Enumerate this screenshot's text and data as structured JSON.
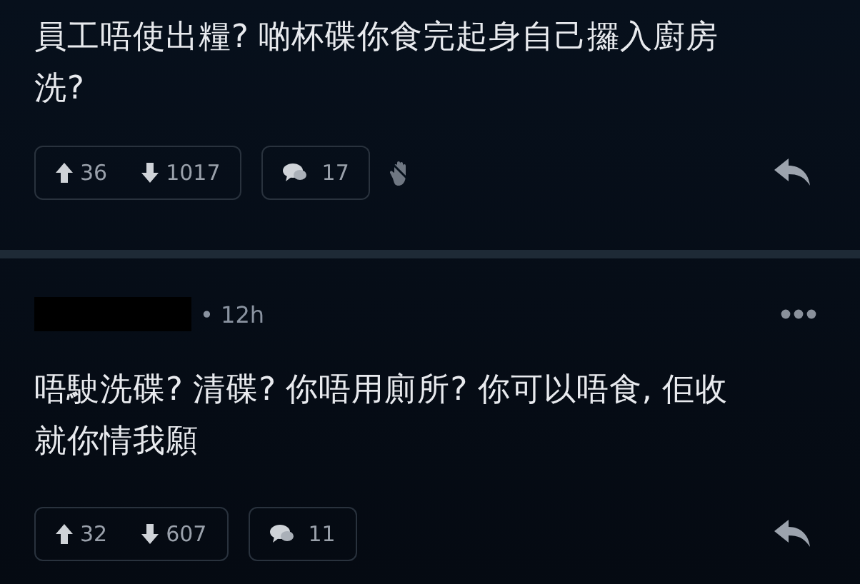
{
  "posts": [
    {
      "kind": "reply",
      "text": "員工唔使出糧? 啲杯碟你食完起身自己攞入廚房洗?",
      "upvotes": "36",
      "downvotes": "1017",
      "comments": "17",
      "reacted": true
    },
    {
      "kind": "comment",
      "author_redacted": true,
      "time": "• 12h",
      "text": "唔駛洗碟? 清碟? 你唔用廁所? 你可以唔食, 佢收就你情我願",
      "upvotes": "32",
      "downvotes": "607",
      "comments": "11",
      "reacted": false
    }
  ]
}
